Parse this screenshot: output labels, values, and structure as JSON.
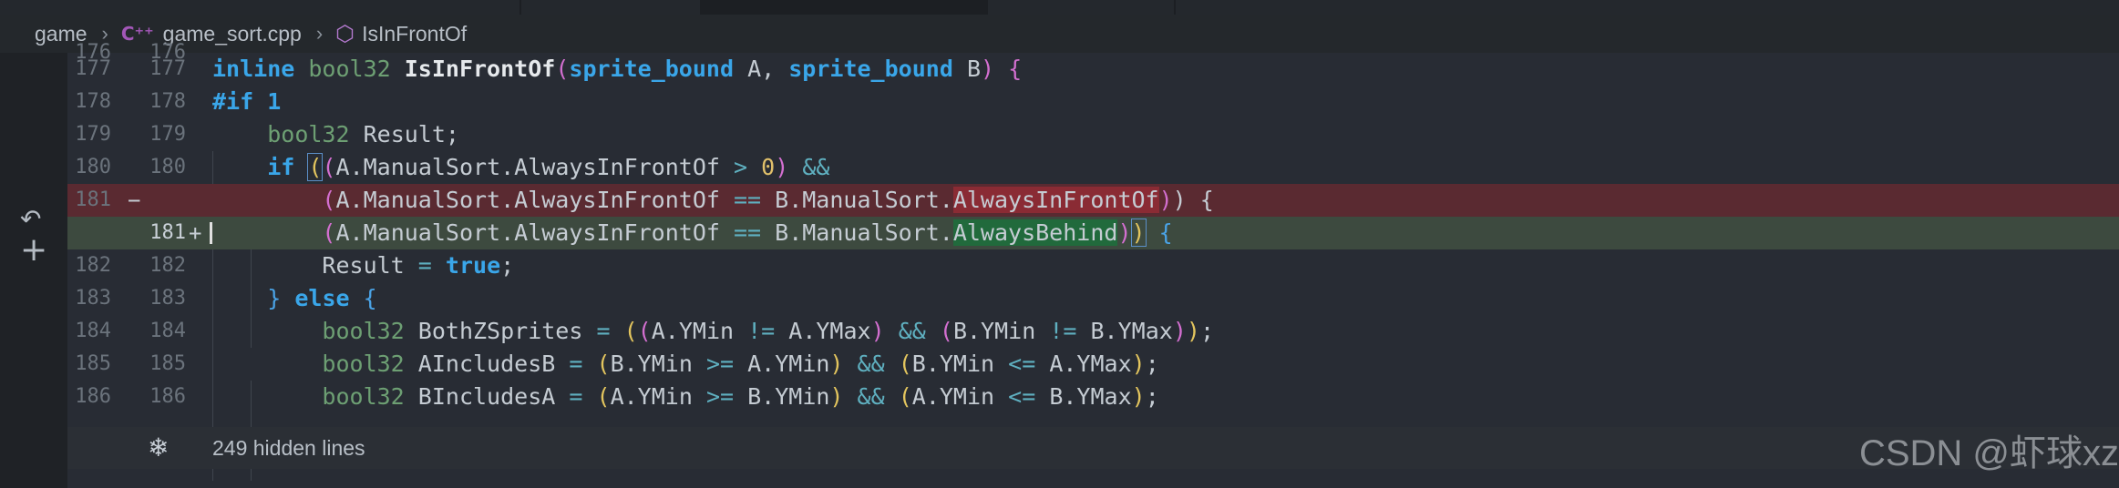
{
  "breadcrumb": {
    "folder": "game",
    "file": "game_sort.cpp",
    "symbol": "IsInFrontOf",
    "file_icon": "cpp-file-icon",
    "symbol_icon": "cube-icon"
  },
  "gutter": {
    "revert_icon": "↶",
    "add_icon": "+"
  },
  "lines": [
    {
      "a": "176",
      "b": "176"
    },
    {
      "a": "177",
      "b": "177"
    },
    {
      "a": "178",
      "b": "178"
    },
    {
      "a": "179",
      "b": "179"
    },
    {
      "a": "180",
      "b": "180"
    },
    {
      "a": "181",
      "b": "",
      "marker": "−"
    },
    {
      "a": "",
      "b": "181",
      "marker": "+"
    },
    {
      "a": "182",
      "b": "182"
    },
    {
      "a": "183",
      "b": "183"
    },
    {
      "a": "184",
      "b": "184"
    },
    {
      "a": "185",
      "b": "185"
    },
    {
      "a": "186",
      "b": "186"
    }
  ],
  "code": {
    "l177": {
      "kw": "inline",
      "type": "bool32",
      "fn": "IsInFrontOf",
      "p1": "sprite_bound",
      "a": "A",
      "p2": "sprite_bound",
      "b": "B"
    },
    "l178": {
      "macro": "#if",
      "num": "1"
    },
    "l179": {
      "type": "bool32",
      "rest": "Result;"
    },
    "l180": {
      "kw": "if",
      "expr": "A.ManualSort.AlwaysInFrontOf",
      "op": ">",
      "num": "0",
      "and": "&&"
    },
    "l181_del": {
      "left": "A.ManualSort.AlwaysInFrontOf",
      "op": "==",
      "mid": "B.ManualSort.",
      "changed": "AlwaysInFrontOf",
      "tail": ") {"
    },
    "l181_add": {
      "left": "A.ManualSort.AlwaysInFrontOf",
      "op": "==",
      "mid": "B.ManualSort.",
      "changed": "AlwaysBehind",
      "tail": "{"
    },
    "l182": {
      "name": "Result",
      "op": "=",
      "val": "true",
      "semi": ";"
    },
    "l183": {
      "brace": "}",
      "kw": "else",
      "open": "{"
    },
    "l184": {
      "type": "bool32",
      "name": "BothZSprites",
      "op": "=",
      "e1": "A.YMin",
      "neq": "!=",
      "e2": "A.YMax",
      "and": "&&",
      "e3": "B.YMin",
      "e4": "B.YMax"
    },
    "l185": {
      "type": "bool32",
      "name": "AIncludesB",
      "op": "=",
      "e1": "B.YMin",
      "ge": ">=",
      "e2": "A.YMin",
      "and": "&&",
      "e3": "B.YMin",
      "le": "<=",
      "e4": "A.YMax"
    },
    "l186": {
      "type": "bool32",
      "name": "BIncludesA",
      "op": "=",
      "e1": "A.YMin",
      "ge": ">=",
      "e2": "B.YMin",
      "and": "&&",
      "e3": "A.YMin",
      "le": "<=",
      "e4": "B.YMax"
    }
  },
  "hidden": {
    "icon": "❄",
    "label": "249 hidden lines"
  },
  "watermark": "CSDN @虾球xz"
}
